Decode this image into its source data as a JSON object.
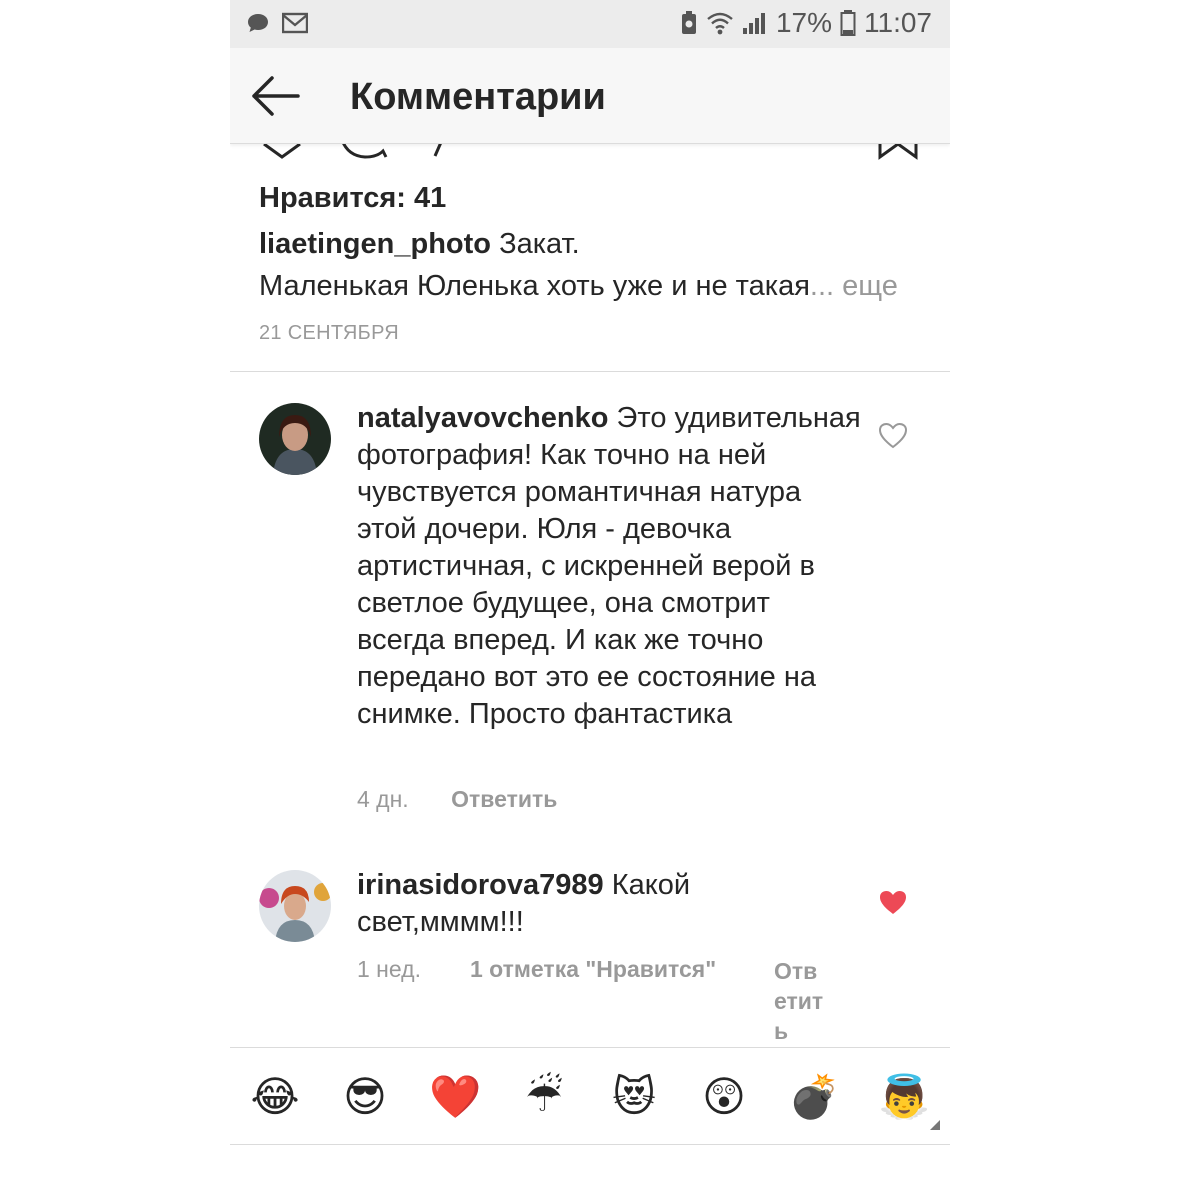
{
  "status_bar": {
    "battery_percent": "17%",
    "time": "11:07"
  },
  "header": {
    "title": "Комментарии"
  },
  "post": {
    "likes_text": "Нравится: 41",
    "author": "liaetingen_photo",
    "caption_start": "Закат.",
    "caption_second_line": "Маленькая Юленька хоть уже и не такая",
    "more_label": "... еще",
    "date": "21 СЕНТЯБРЯ"
  },
  "comments": [
    {
      "username": "natalyavovchenko",
      "text": "Это удивительная фотография! Как точно на ней чувствуется романтичная натура этой дочери. Юля - девочка артистичная, с искренней верой в светлое будущее, она смотрит всегда вперед. И как же точно передано вот это ее состояние на снимке. Просто фантастика",
      "time": "4 дн.",
      "reply_label": "Ответить",
      "liked": false
    },
    {
      "username": "irinasidorova7989",
      "text": "Какой свет,мммм!!!",
      "time": "1 нед.",
      "likes_label": "1 отметка \"Нравится\"",
      "reply_label": "Ответить",
      "liked": true
    }
  ],
  "emoji_bar": {
    "items": [
      "😂",
      "😎",
      "❤️",
      "☔",
      "😻",
      "😲",
      "💣",
      "👼"
    ]
  },
  "colors": {
    "liked_heart": "#ed4956",
    "secondary_text": "#999999",
    "header_bg": "#f7f7f7"
  }
}
